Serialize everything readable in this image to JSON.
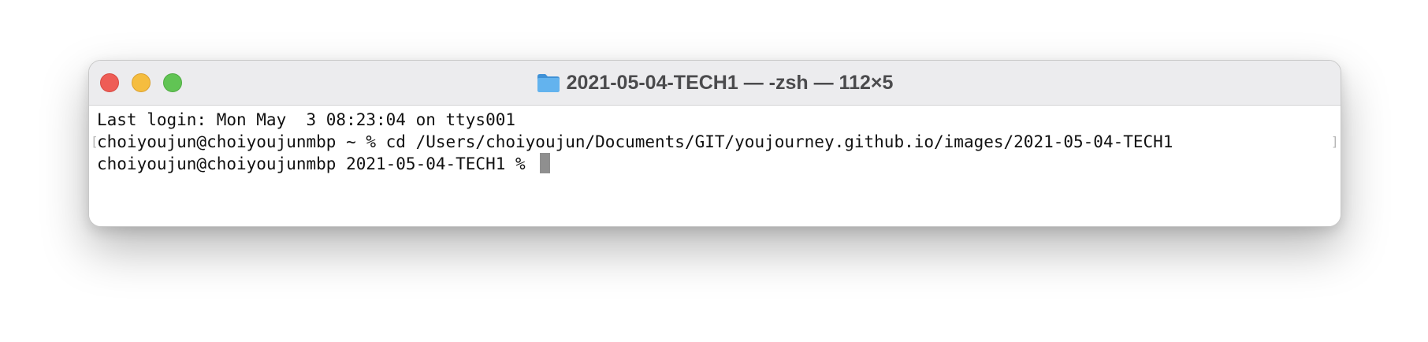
{
  "window": {
    "title": "2021-05-04-TECH1 — -zsh — 112×5",
    "title_icon": "folder-icon"
  },
  "terminal": {
    "lines": [
      "Last login: Mon May  3 08:23:04 on ttys001",
      "choiyoujun@choiyoujunmbp ~ % cd /Users/choiyoujun/Documents/GIT/youjourney.github.io/images/2021-05-04-TECH1",
      "choiyoujun@choiyoujunmbp 2021-05-04-TECH1 % "
    ],
    "mark_left": "[",
    "mark_right": "]"
  },
  "colors": {
    "close": "#ee5d56",
    "minimize": "#f5bd3f",
    "zoom": "#61c454",
    "folder": "#5aa9e6",
    "cursor": "#8f8f8f"
  }
}
